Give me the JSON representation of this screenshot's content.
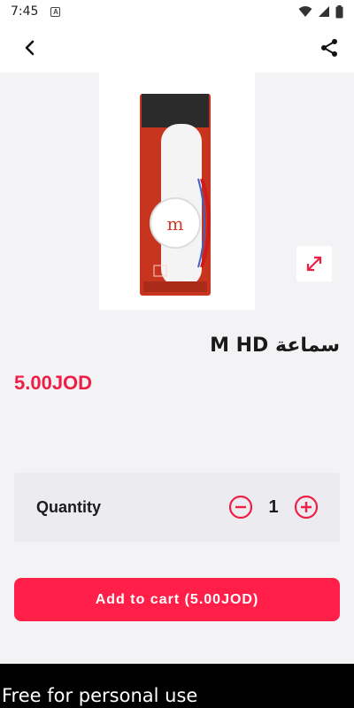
{
  "status_bar": {
    "time": "7:45",
    "app_icon_letter": "A"
  },
  "app_bar": {
    "back_icon": "back-arrow-icon",
    "share_icon": "share-icon"
  },
  "product": {
    "image_alt": "product-image",
    "title": "سماعة M HD",
    "price": "5.00JOD"
  },
  "quantity": {
    "label": "Quantity",
    "value": "1"
  },
  "cart": {
    "button_label": "Add to cart (5.00JOD)"
  },
  "watermark": {
    "text": "Free for personal use"
  },
  "colors": {
    "accent": "#ff1f48",
    "price": "#ee1f45",
    "background": "#f3f3f5"
  }
}
